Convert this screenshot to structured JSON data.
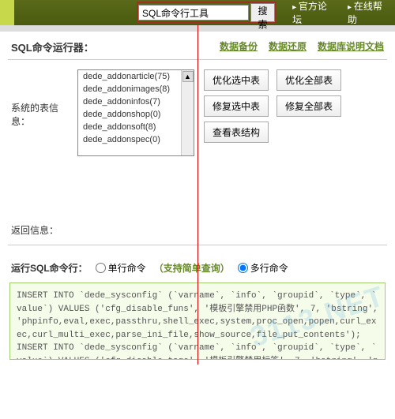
{
  "topbar": {
    "search_value": "SQL命令行工具",
    "search_btn": "搜索",
    "links": [
      "官方论坛",
      "在线帮助"
    ]
  },
  "header": {
    "title": "SQL命令运行器：",
    "links": [
      "数据备份",
      "数据还原",
      "数据库说明文档"
    ]
  },
  "tables": {
    "label": "系统的表信息：",
    "items": [
      "dede_addonarticle(75)",
      "dede_addonimages(8)",
      "dede_addoninfos(7)",
      "dede_addonshop(0)",
      "dede_addonsoft(8)",
      "dede_addonspec(0)"
    ]
  },
  "buttons": {
    "opt_sel": "优化选中表",
    "opt_all": "优化全部表",
    "rep_sel": "修复选中表",
    "rep_all": "修复全部表",
    "view": "查看表结构"
  },
  "return_label": "返回信息：",
  "sqlrow": {
    "label": "运行SQL命令行：",
    "opt1": "单行命令",
    "hint": "（支持简单查询）",
    "opt2": "多行命令"
  },
  "sql_text": "INSERT INTO `dede_sysconfig` (`varname`, `info`, `groupid`, `type`, `value`) VALUES ('cfg_disable_funs', '模板引擎禁用PHP函数', 7, 'bstring', 'phpinfo,eval,exec,passthru,shell_exec,system,proc_open,popen,curl_exec,curl_multi_exec,parse_ini_file,show_source,file_put_contents');\nINSERT INTO `dede_sysconfig` (`varname`, `info`, `groupid`, `type`, `value`) VALUES ('cfg_disable_tags', '模板引擎禁用标签', 7, 'bstring', 'php');",
  "watermark": "3113.NET"
}
